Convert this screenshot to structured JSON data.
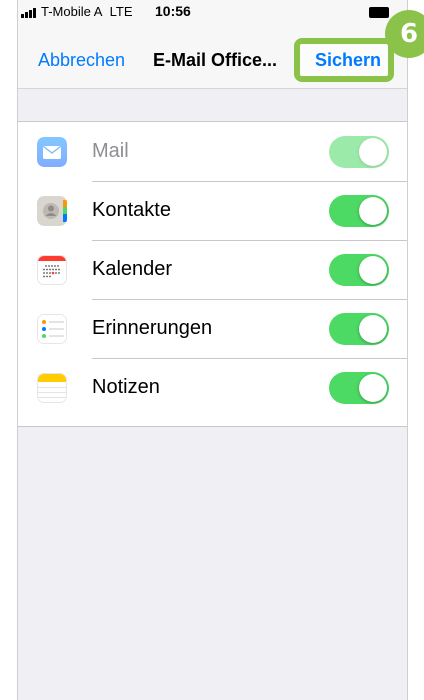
{
  "status_bar": {
    "carrier": "T-Mobile A",
    "network": "LTE",
    "time": "10:56"
  },
  "nav": {
    "cancel_label": "Abbrechen",
    "title": "E-Mail Office...",
    "save_label": "Sichern"
  },
  "step_badge": "6",
  "items": [
    {
      "label": "Mail",
      "enabled": true,
      "disabled": true,
      "icon": "mail-icon"
    },
    {
      "label": "Kontakte",
      "enabled": true,
      "disabled": false,
      "icon": "contacts-icon"
    },
    {
      "label": "Kalender",
      "enabled": true,
      "disabled": false,
      "icon": "calendar-icon"
    },
    {
      "label": "Erinnerungen",
      "enabled": true,
      "disabled": false,
      "icon": "reminders-icon"
    },
    {
      "label": "Notizen",
      "enabled": true,
      "disabled": false,
      "icon": "notes-icon"
    }
  ],
  "colors": {
    "accent": "#007aff",
    "toggle_on": "#4cd964",
    "highlight": "#8bc34a"
  }
}
